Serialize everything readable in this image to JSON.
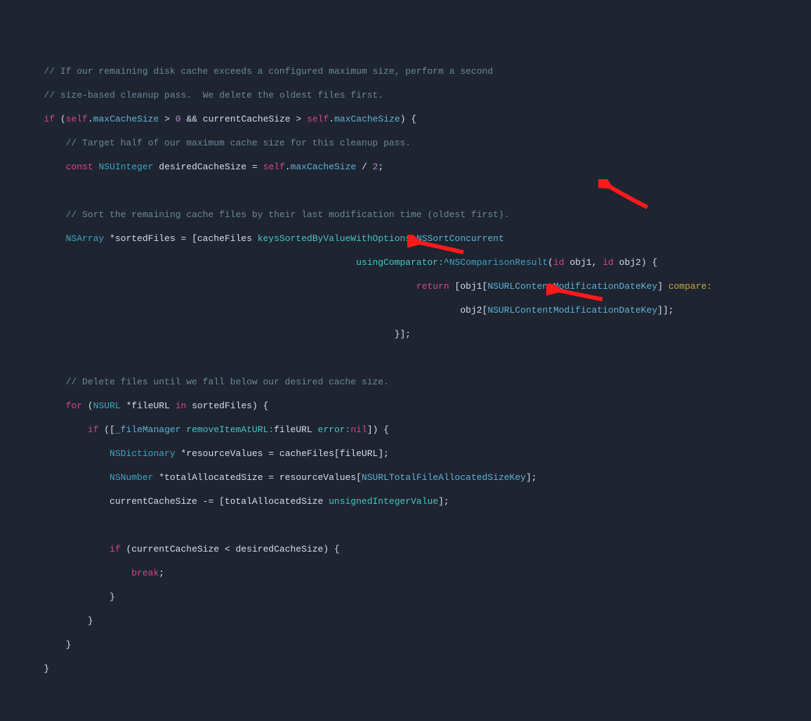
{
  "code": {
    "l1": "// If our remaining disk cache exceeds a configured maximum size, perform a second",
    "l2": "// size-based cleanup pass.  We delete the oldest files first.",
    "l3a": "if",
    "l3b": "self",
    "l3c": "maxCacheSize",
    "l3d": ">",
    "l3e": "0",
    "l3f": "&&",
    "l3g": "currentCacheSize",
    "l3h": ">",
    "l3i": "self",
    "l3j": "maxCacheSize",
    "l3k": ") {",
    "l4": "// Target half of our maximum cache size for this cleanup pass.",
    "l5a": "const",
    "l5b": "NSUInteger",
    "l5c": "desiredCacheSize",
    "l5d": "=",
    "l5e": "self",
    "l5f": "maxCacheSize",
    "l5g": "/",
    "l5h": "2",
    "l5i": ";",
    "l7": "// Sort the remaining cache files by their last modification time (oldest first).",
    "l8a": "NSArray",
    "l8b": "*sortedFiles = [cacheFiles ",
    "l8c": "keysSortedByValueWithOptions:",
    "l8d": "NSSortConcurrent",
    "l9a": "usingComparator:",
    "l9b": "^",
    "l9c": "NSComparisonResult",
    "l9d": "(",
    "l9e": "id",
    "l9f": "obj1, ",
    "l9g": "id",
    "l9h": "obj2) {",
    "l10a": "return",
    "l10b": "[obj1[",
    "l10c": "NSURLContentModificationDateKey",
    "l10d": "]",
    "l10e": "compare:",
    "l11a": "obj2[",
    "l11b": "NSURLContentModificationDateKey",
    "l11c": "]];",
    "l12": "}];",
    "l14": "// Delete files until we fall below our desired cache size.",
    "l15a": "for",
    "l15b": "(",
    "l15c": "NSURL",
    "l15d": "*fileURL ",
    "l15e": "in",
    "l15f": "sortedFiles) {",
    "l16a": "if",
    "l16b": "([",
    "l16c": "_fileManager",
    "l16d": "removeItemAtURL:",
    "l16e": "fileURL ",
    "l16f": "error:",
    "l16g": "nil",
    "l16h": "]) {",
    "l17a": "NSDictionary",
    "l17b": "*resourceValues = cacheFiles[fileURL];",
    "l18a": "NSNumber",
    "l18b": "*totalAllocatedSize = resourceValues[",
    "l18c": "NSURLTotalFileAllocatedSizeKey",
    "l18d": "];",
    "l19a": "currentCacheSize -= [totalAllocatedSize ",
    "l19b": "unsignedIntegerValue",
    "l19c": "];",
    "l21a": "if",
    "l21b": "(currentCacheSize < desiredCacheSize) {",
    "l22a": "break",
    "l22b": ";",
    "l23": "}",
    "l24": "}",
    "l25": "}",
    "l26": "}"
  },
  "indents": {
    "i0": "        ",
    "i1": "            ",
    "i2": "                ",
    "i3": "                    ",
    "i4": "                        ",
    "sort1": "                                                    ",
    "sort2": "                                                        ",
    "sort3": "                                                                    ",
    "sort4": "                                                                        "
  }
}
